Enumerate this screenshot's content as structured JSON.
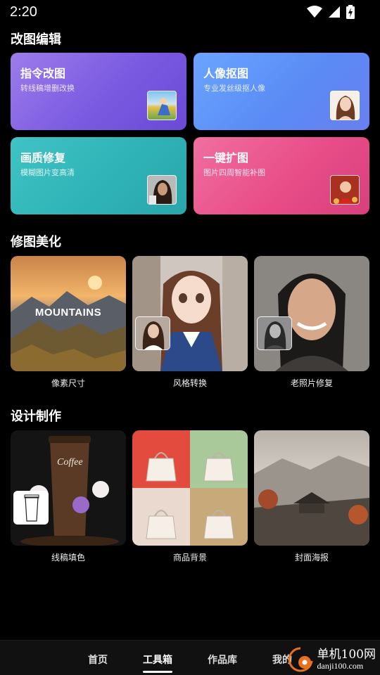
{
  "status_bar": {
    "time": "2:20"
  },
  "sections": {
    "edit": {
      "title": "改图编辑",
      "cards": [
        {
          "title": "指令改图",
          "subtitle": "转线稿增删改换"
        },
        {
          "title": "人像抠图",
          "subtitle": "专业发丝级抠人像"
        },
        {
          "title": "画质修复",
          "subtitle": "模糊图片变高清"
        },
        {
          "title": "一键扩图",
          "subtitle": "图片四周智能补图"
        }
      ]
    },
    "retouch": {
      "title": "修图美化",
      "tiles": [
        {
          "label": "像素尺寸",
          "overlay_text": "MOUNTAINS"
        },
        {
          "label": "风格转换"
        },
        {
          "label": "老照片修复"
        }
      ]
    },
    "design": {
      "title": "设计制作",
      "tiles": [
        {
          "label": "线稿填色",
          "overlay_text": "Coffee"
        },
        {
          "label": "商品背景"
        },
        {
          "label": "封面海报"
        }
      ]
    }
  },
  "bottom_nav": {
    "items": [
      {
        "label": "首页",
        "active": false
      },
      {
        "label": "工具箱",
        "active": true
      },
      {
        "label": "作品库",
        "active": false
      },
      {
        "label": "我的",
        "active": false
      }
    ]
  },
  "watermark": {
    "cn": "单机100网",
    "en": "danji100.com"
  }
}
